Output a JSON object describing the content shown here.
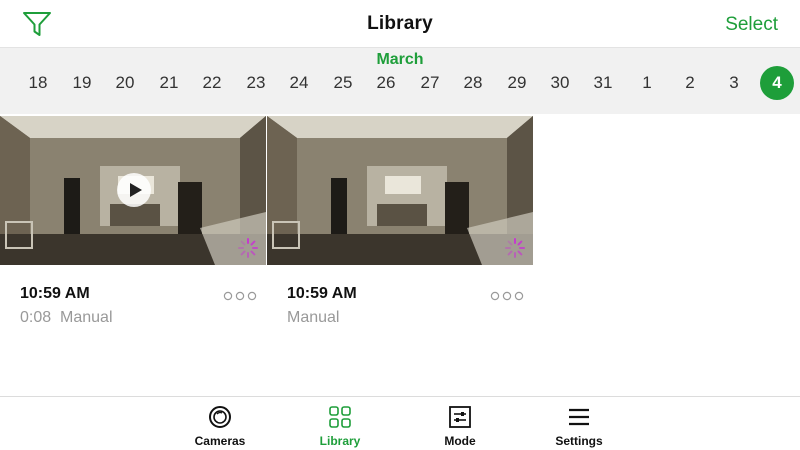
{
  "header": {
    "title": "Library",
    "select_label": "Select",
    "filter_icon": "filter-icon"
  },
  "colors": {
    "accent": "#1e9e3a",
    "datebar_bg": "#f1f1f1",
    "muted_text": "#999999",
    "spinner": "#c63ad0"
  },
  "datebar": {
    "month": "March",
    "days": [
      "18",
      "19",
      "20",
      "21",
      "22",
      "23",
      "24",
      "25",
      "26",
      "27",
      "28",
      "29",
      "30",
      "31",
      "1",
      "2",
      "3",
      "4"
    ],
    "selected_day": "4"
  },
  "clips": [
    {
      "time": "10:59 AM",
      "duration": "0:08",
      "type": "Manual",
      "has_play": true,
      "status": "loading"
    },
    {
      "time": "10:59 AM",
      "duration": "",
      "type": "Manual",
      "has_play": false,
      "status": "loading"
    }
  ],
  "tabs": [
    {
      "label": "Cameras",
      "icon": "camera-lens-icon",
      "active": false
    },
    {
      "label": "Library",
      "icon": "grid-icon",
      "active": true
    },
    {
      "label": "Mode",
      "icon": "sliders-icon",
      "active": false
    },
    {
      "label": "Settings",
      "icon": "menu-icon",
      "active": false
    }
  ]
}
